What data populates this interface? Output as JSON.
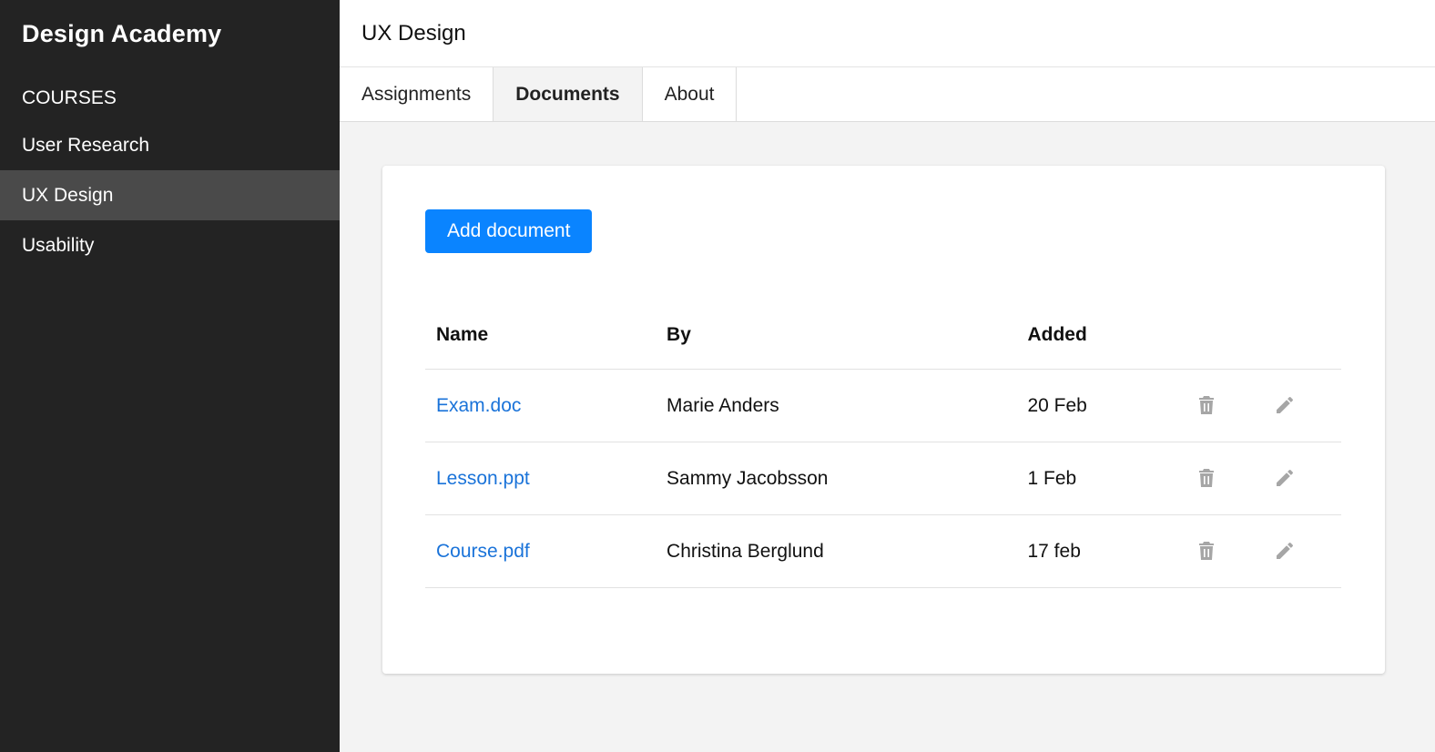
{
  "sidebar": {
    "brand": "Design Academy",
    "section_label": "COURSES",
    "items": [
      {
        "label": "User Research",
        "active": false
      },
      {
        "label": "UX Design",
        "active": true
      },
      {
        "label": "Usability",
        "active": false
      }
    ]
  },
  "header": {
    "title": "UX Design"
  },
  "tabs": [
    {
      "label": "Assignments",
      "active": false
    },
    {
      "label": "Documents",
      "active": true
    },
    {
      "label": "About",
      "active": false
    }
  ],
  "main": {
    "add_button_label": "Add document",
    "table": {
      "columns": [
        "Name",
        "By",
        "Added"
      ],
      "rows": [
        {
          "name": "Exam.doc",
          "by": "Marie Anders",
          "added": "20 Feb"
        },
        {
          "name": "Lesson.ppt",
          "by": "Sammy Jacobsson",
          "added": "1 Feb"
        },
        {
          "name": "Course.pdf",
          "by": "Christina Berglund",
          "added": "17 feb"
        }
      ]
    }
  },
  "icons": {
    "delete": "trash-icon",
    "edit": "pencil-icon"
  },
  "colors": {
    "sidebar_bg": "#232323",
    "sidebar_active": "#4a4a4a",
    "primary": "#0a84ff",
    "link": "#1a73d9",
    "icon_gray": "#a6a6a6"
  }
}
